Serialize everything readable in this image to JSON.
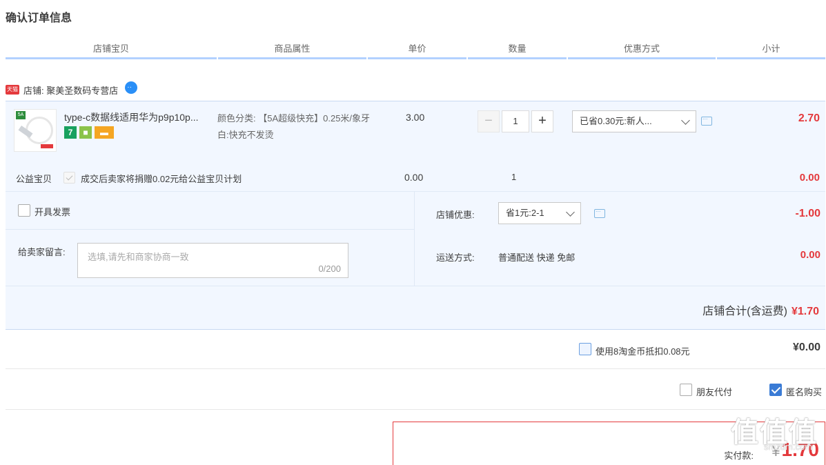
{
  "page_title": "确认订单信息",
  "columns": [
    "店铺宝贝",
    "商品属性",
    "单价",
    "数量",
    "优惠方式",
    "小计"
  ],
  "shop": {
    "badge": "天猫",
    "label": "店铺: 聚美圣数码专营店"
  },
  "item": {
    "title": "type-c数据线适用华为p9p10p...",
    "thumb_tag": "5A",
    "attributes": "颜色分类: 【5A超级快充】0.25米/象牙白:快充不发烫",
    "unit_price": "3.00",
    "quantity": "1",
    "minus": "−",
    "plus": "+",
    "discount": "已省0.30元:新人...",
    "subtotal": "2.70"
  },
  "charity": {
    "label": "公益宝贝",
    "text": "成交后卖家将捐赠0.02元给公益宝贝计划",
    "price": "0.00",
    "quantity": "1",
    "subtotal": "0.00"
  },
  "invoice": {
    "label": "开具发票"
  },
  "message": {
    "label": "给卖家留言:",
    "placeholder": "选填,请先和商家协商一致",
    "count": "0/200"
  },
  "shop_discount": {
    "label": "店铺优惠:",
    "value": "省1元:2-1",
    "amount": "-1.00"
  },
  "shipping": {
    "label": "运送方式:",
    "value": "普通配送 快递 免邮",
    "amount": "0.00"
  },
  "shop_total": {
    "label": "店铺合计(含运费)",
    "amount": "¥1.70"
  },
  "coins": {
    "label": "使用8淘金币抵扣0.08元",
    "amount": "¥0.00"
  },
  "options": {
    "friend_pay": "朋友代付",
    "anonymous": "匿名购买"
  },
  "payment": {
    "label": "实付款:",
    "yen": "¥",
    "amount": "1.70"
  },
  "watermark": {
    "main": "值值值",
    "sub": "smzdm.com"
  },
  "colors": {
    "accent_red": "#e4393c",
    "header_bar": "#b2d1ff",
    "panel_bg": "#f2f7ff"
  }
}
